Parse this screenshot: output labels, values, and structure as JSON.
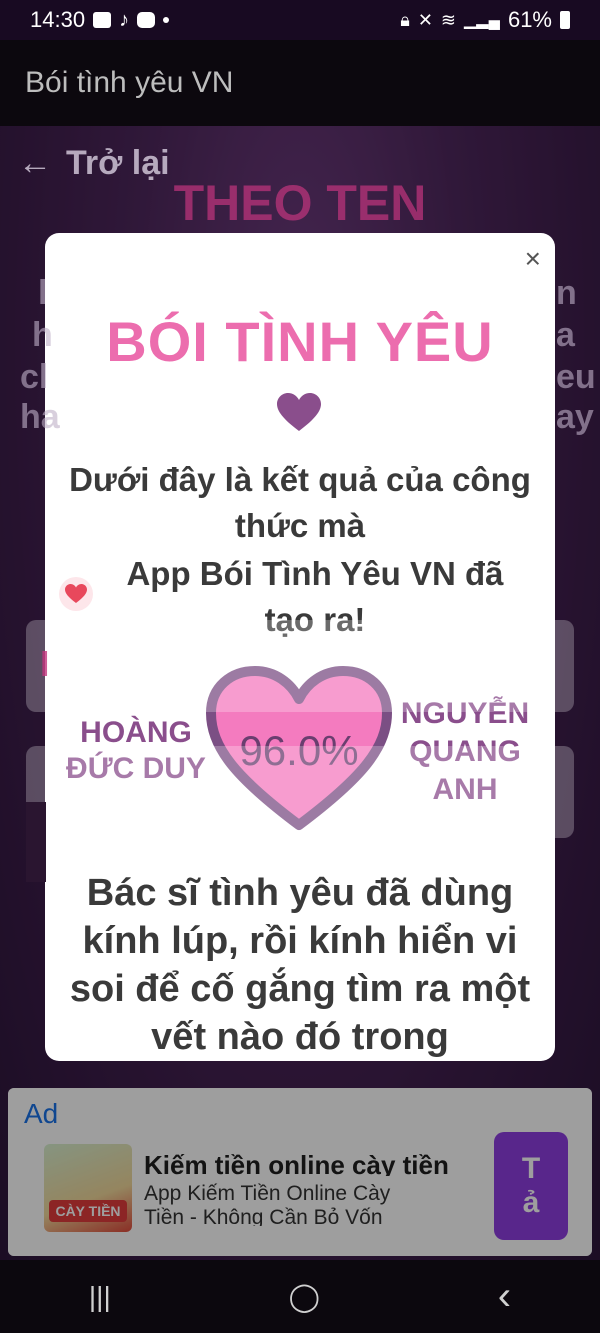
{
  "status": {
    "time": "14:30",
    "battery": "61%"
  },
  "app": {
    "title": "Bói tình yêu VN"
  },
  "background": {
    "back_label": "Trở lại",
    "title": "THEO TEN",
    "partial_lines": [
      "l",
      "h",
      "cl",
      "ha",
      "n",
      "a",
      "eu",
      "ay",
      "l"
    ]
  },
  "dialog": {
    "close": "×",
    "title": "BÓI TÌNH YÊU",
    "intro": "Dưới đây là kết quả của công thức mà",
    "intro2": "App Bói Tình Yêu VN đã tạo ra!",
    "name_left": "HOÀNG ĐỨC DUY",
    "name_right": "NGUYỄN QUANG ANH",
    "percent": "96.0%",
    "body": "Bác sĩ tình yêu đã dùng kính lúp, rồi kính hiển vi soi để cố gắng tìm ra một vết nào đó trong"
  },
  "ad": {
    "label": "Ad",
    "thumb_text": "CÀY TIỀN",
    "title": "Kiếm tiền online cày tiền",
    "desc": "App Kiếm Tiền Online Cày Tiền - Không Cần Bỏ Vốn",
    "button_line1": "T",
    "button_line2": "ả"
  },
  "nav": {
    "recents": "|||",
    "home": "◯",
    "back": "‹"
  },
  "colors": {
    "accent_pink": "#ec6dae",
    "heart_fill": "#f47bbf",
    "heart_border": "#7b4f84",
    "names": "#8a4e8c"
  }
}
